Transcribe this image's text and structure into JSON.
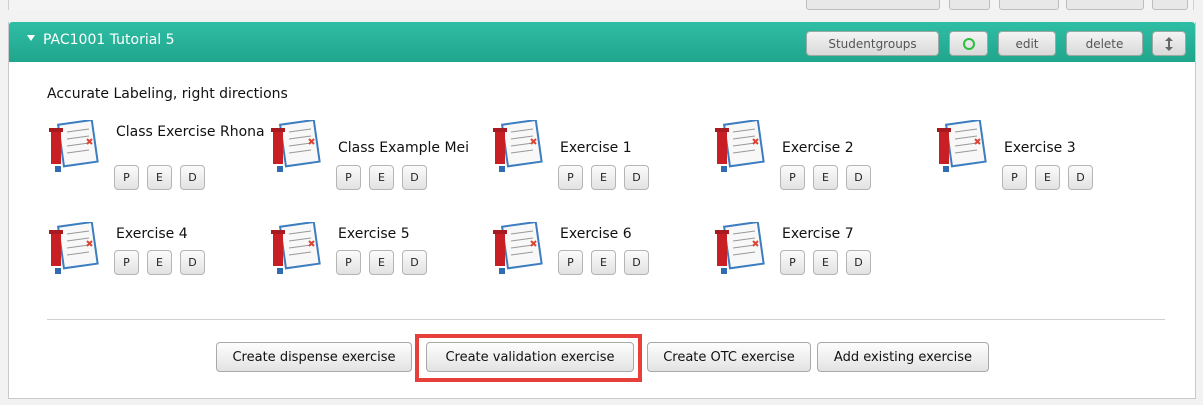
{
  "panel": {
    "title": "PAC1001 Tutorial 5",
    "header_buttons": {
      "studentgroups": "Studentgroups",
      "edit": "edit",
      "delete": "delete"
    },
    "description": "Accurate Labeling, right directions",
    "exercises": [
      {
        "title": "Class Exercise Rhona",
        "p": "P",
        "e": "E",
        "d": "D"
      },
      {
        "title": "Class Example Mei",
        "p": "P",
        "e": "E",
        "d": "D"
      },
      {
        "title": "Exercise 1",
        "p": "P",
        "e": "E",
        "d": "D"
      },
      {
        "title": "Exercise 2",
        "p": "P",
        "e": "E",
        "d": "D"
      },
      {
        "title": "Exercise 3",
        "p": "P",
        "e": "E",
        "d": "D"
      },
      {
        "title": "Exercise 4",
        "p": "P",
        "e": "E",
        "d": "D"
      },
      {
        "title": "Exercise 5",
        "p": "P",
        "e": "E",
        "d": "D"
      },
      {
        "title": "Exercise 6",
        "p": "P",
        "e": "E",
        "d": "D"
      },
      {
        "title": "Exercise 7",
        "p": "P",
        "e": "E",
        "d": "D"
      }
    ],
    "actions": {
      "dispense": "Create dispense exercise",
      "validation": "Create validation exercise",
      "otc": "Create OTC exercise",
      "add_existing": "Add existing exercise"
    }
  },
  "icons": {
    "collapse": "caret-down-icon",
    "status": "green-circle-icon",
    "reorder": "up-down-arrow-icon",
    "exercise": "prescription-document-icon"
  },
  "colors": {
    "header": "#24ad95",
    "highlight": "#e7403a",
    "status": "#2cbf3c"
  }
}
